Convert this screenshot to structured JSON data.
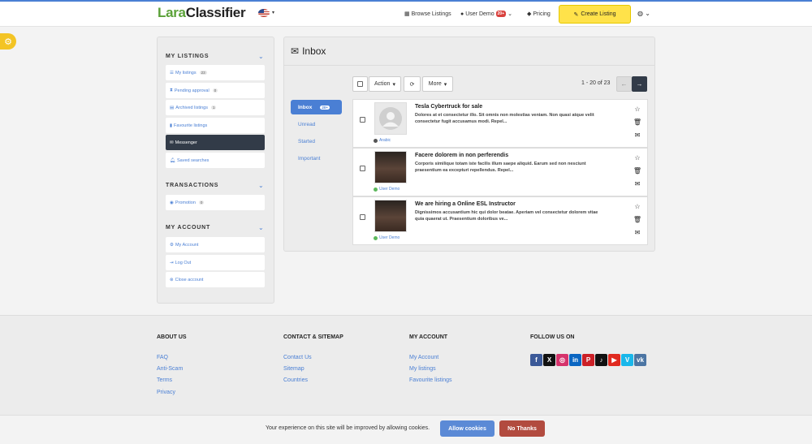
{
  "header": {
    "logo_part1": "Lara",
    "logo_part2": "Classifier",
    "browse_label": "Browse Listings",
    "user_label": "User Demo",
    "user_badge": "20+",
    "pricing_label": "Pricing",
    "create_label": "Create Listing"
  },
  "sidebar": {
    "my_listings_title": "MY LISTINGS",
    "my_listings": [
      {
        "label": "My listings",
        "count": "23"
      },
      {
        "label": "Pending approval",
        "count": "0"
      },
      {
        "label": "Archived listings",
        "count": "1"
      },
      {
        "label": "Favourite listings",
        "count": ""
      },
      {
        "label": "Messenger",
        "count": ""
      },
      {
        "label": "Saved searches",
        "count": ""
      }
    ],
    "transactions_title": "TRANSACTIONS",
    "transactions": [
      {
        "label": "Promotion",
        "count": "0"
      }
    ],
    "my_account_title": "MY ACCOUNT",
    "my_account": [
      {
        "label": "My Account"
      },
      {
        "label": "Log Out"
      },
      {
        "label": "Close account"
      }
    ]
  },
  "inbox": {
    "title": "Inbox",
    "toolbar": {
      "action_label": "Action",
      "more_label": "More",
      "pagination": "1 - 20 of 23"
    },
    "folders": [
      {
        "label": "Inbox",
        "badge": "20+"
      },
      {
        "label": "Unread"
      },
      {
        "label": "Started"
      },
      {
        "label": "Important"
      }
    ],
    "messages": [
      {
        "subject": "Tesla Cybertruck for sale",
        "body": "Dolores at et consectetur illo. Sit omnis non molestias veniam. Non quasi atque velit consectetur fugit accusamus modi. Repel...",
        "from": "Arabic",
        "status_color": "#555555"
      },
      {
        "subject": "Facere dolorem in non perferendis",
        "body": "Corporis similique totam iste facilis illum saepe aliquid. Earum sed non nesciunt praesentium ea excepturi repellendus. Repel...",
        "from": "User Demo",
        "status_color": "#5cb85c"
      },
      {
        "subject": "We are hiring a Online ESL Instructor",
        "body": "Dignissimos accusantium hic qui dolor beatae. Aperiam vel consectetur dolorem vitae quia quaerat ut. Praesentium doloribus ve...",
        "from": "User Demo",
        "status_color": "#5cb85c"
      }
    ]
  },
  "footer": {
    "about_title": "ABOUT US",
    "about_links": [
      "FAQ",
      "Anti-Scam",
      "Terms",
      "Privacy"
    ],
    "contact_title": "CONTACT & SITEMAP",
    "contact_links": [
      "Contact Us",
      "Sitemap",
      "Countries"
    ],
    "account_title": "MY ACCOUNT",
    "account_links": [
      "My Account",
      "My listings",
      "Favourite listings"
    ],
    "follow_title": "FOLLOW US ON",
    "social": [
      {
        "name": "facebook-icon",
        "glyph": "f",
        "color": "#3b5998"
      },
      {
        "name": "x-icon",
        "glyph": "X",
        "color": "#111111"
      },
      {
        "name": "instagram-icon",
        "glyph": "◎",
        "color": "#d6336c"
      },
      {
        "name": "linkedin-icon",
        "glyph": "in",
        "color": "#0a66c2"
      },
      {
        "name": "pinterest-icon",
        "glyph": "P",
        "color": "#cb2027"
      },
      {
        "name": "tiktok-icon",
        "glyph": "♪",
        "color": "#111111"
      },
      {
        "name": "youtube-icon",
        "glyph": "▶",
        "color": "#e02a20"
      },
      {
        "name": "vimeo-icon",
        "glyph": "V",
        "color": "#1ab7ea"
      },
      {
        "name": "vk-icon",
        "glyph": "vk",
        "color": "#4c75a3"
      }
    ]
  },
  "cookie": {
    "text": "Your experience on this site will be improved by allowing cookies.",
    "allow_label": "Allow cookies",
    "deny_label": "No Thanks"
  },
  "colors": {
    "accent": "#4a7fd4",
    "create_button": "#ffe24a",
    "allow_button": "#5b8ad6",
    "deny_button": "#b24b3f"
  }
}
